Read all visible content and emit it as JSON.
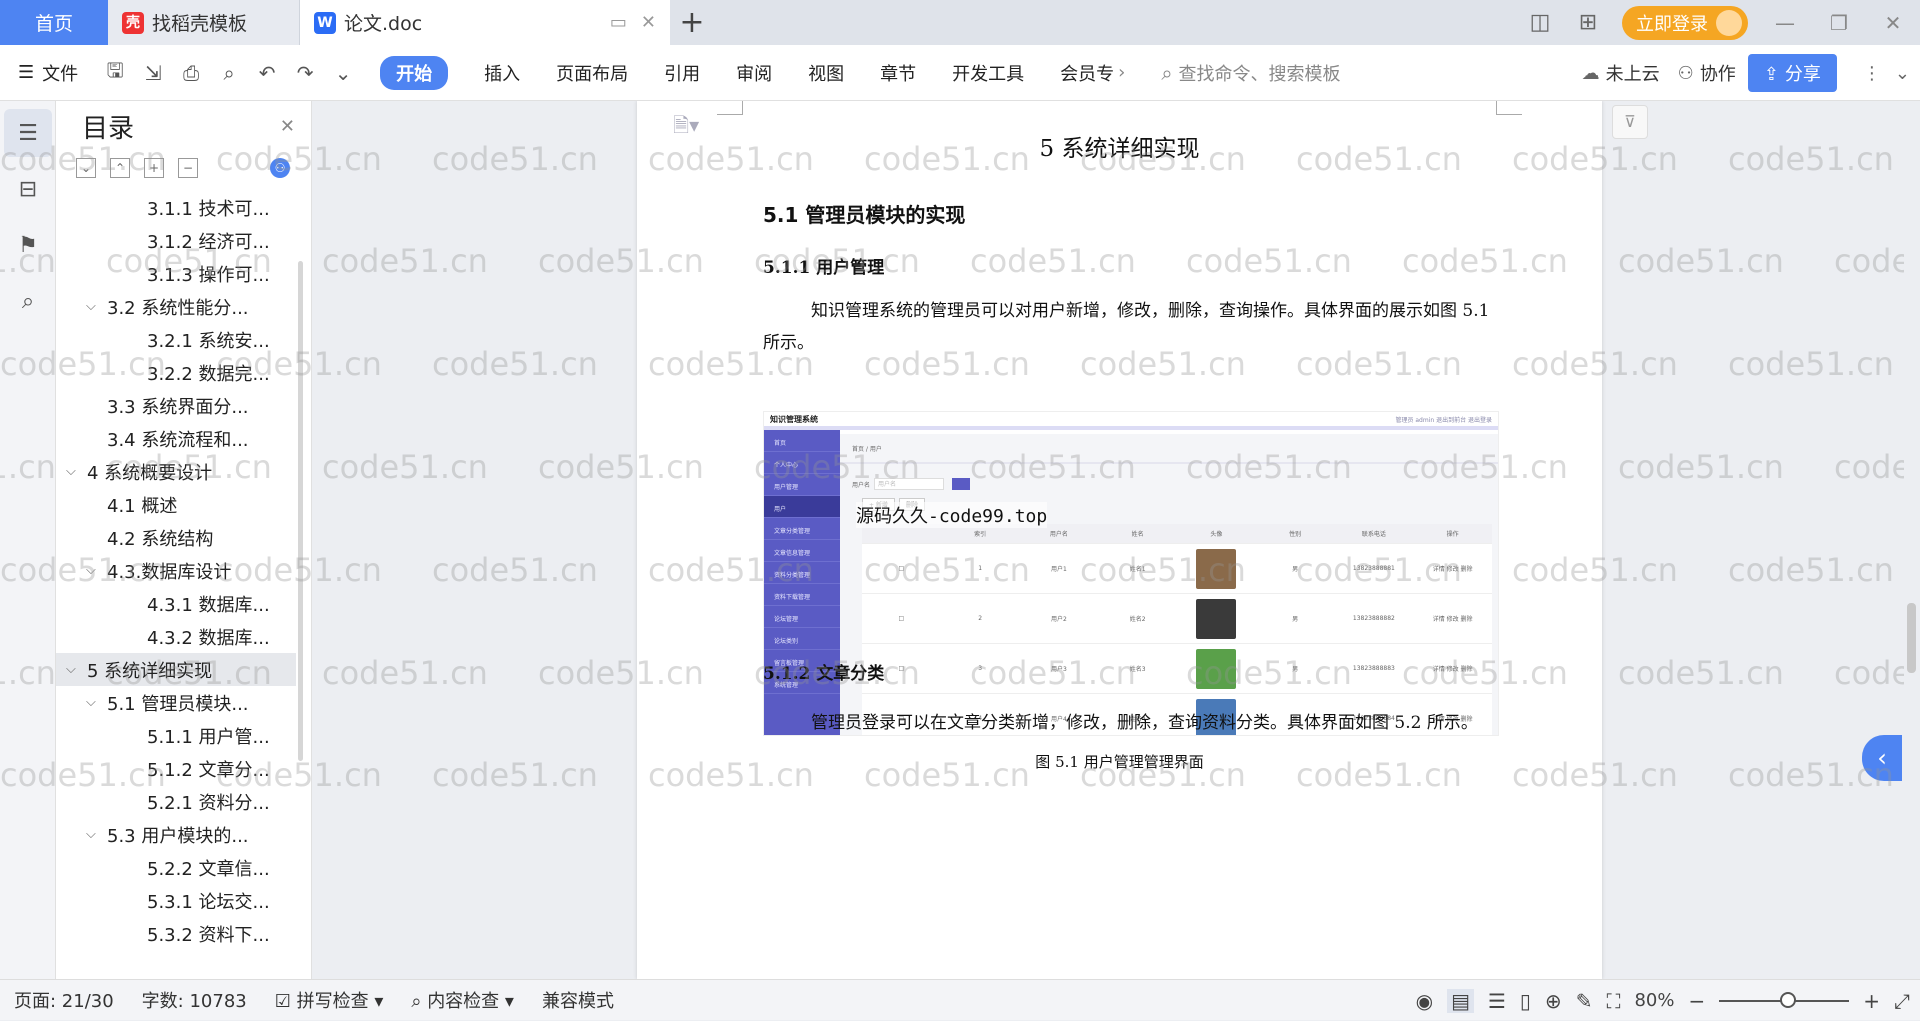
{
  "titlebar": {
    "tabs": [
      {
        "label": "首页"
      },
      {
        "label": "找稻壳模板"
      },
      {
        "label": "论文.doc"
      }
    ],
    "login_label": "立即登录"
  },
  "menubar": {
    "file_label": "文件",
    "items": [
      "开始",
      "插入",
      "页面布局",
      "引用",
      "审阅",
      "视图",
      "章节",
      "开发工具",
      "会员专"
    ],
    "search_placeholder": "查找命令、搜索模板",
    "cloud_label": "未上云",
    "collab_label": "协作",
    "share_label": "分享"
  },
  "toc": {
    "title": "目录",
    "items": [
      {
        "label": "3.1.1 技术可...",
        "level": 3
      },
      {
        "label": "3.1.2 经济可...",
        "level": 3
      },
      {
        "label": "3.1.3 操作可...",
        "level": 3
      },
      {
        "label": "3.2 系统性能分...",
        "level": 2,
        "expanded": true
      },
      {
        "label": "3.2.1  系统安...",
        "level": 3
      },
      {
        "label": "3.2.2  数据完...",
        "level": 3
      },
      {
        "label": "3.3 系统界面分...",
        "level": 2
      },
      {
        "label": "3.4 系统流程和...",
        "level": 2
      },
      {
        "label": "4 系统概要设计",
        "level": 1,
        "expanded": true
      },
      {
        "label": "4.1 概述",
        "level": 2
      },
      {
        "label": "4.2 系统结构",
        "level": 2
      },
      {
        "label": "4.3.数据库设计",
        "level": 2,
        "expanded": true
      },
      {
        "label": "4.3.1 数据库...",
        "level": 3
      },
      {
        "label": "4.3.2 数据库...",
        "level": 3
      },
      {
        "label": "5 系统详细实现",
        "level": 1,
        "expanded": true,
        "selected": true
      },
      {
        "label": "5.1  管理员模块...",
        "level": 2,
        "expanded": true
      },
      {
        "label": "5.1.1  用户管...",
        "level": 3
      },
      {
        "label": "5.1.2  文章分...",
        "level": 3
      },
      {
        "label": "5.2.1  资料分...",
        "level": 3
      },
      {
        "label": "5.3  用户模块的...",
        "level": 2,
        "expanded": true
      },
      {
        "label": "5.2.2  文章信...",
        "level": 3
      },
      {
        "label": "5.3.1  论坛交...",
        "level": 3
      },
      {
        "label": "5.3.2  资料下...",
        "level": 3
      }
    ]
  },
  "document": {
    "chapter_title": "5 系统详细实现",
    "section_title": "5.1  管理员模块的实现",
    "sub1_title": "5.1.1  用户管理",
    "para1": "知识管理系统的管理员可以对用户新增，修改，删除，查询操作。具体界面的展示如图 5.1 所示。",
    "figure_caption": "图 5.1  用户管理管理界面",
    "sub2_title": "5.1.2  文章分类",
    "para2": "管理员登录可以在文章分类新增，修改，删除，查询资料分类。具体界面如图 5.2 所示。",
    "overlay_watermark": "源码久久-code99.top",
    "watermark": "code51.cn"
  },
  "screenshot": {
    "app_title": "知识管理系统",
    "top_links": "管理员 admin    退出到前台    退出登录",
    "breadcrumb": "首页 / 用户",
    "search_label": "用户名",
    "search_placeholder": "用户名",
    "add_label": "+ 新增",
    "del_label": "删除",
    "menu": [
      "首页",
      "个人中心",
      "用户管理",
      "用户",
      "文章分类管理",
      "文章信息管理",
      "资料分类管理",
      "资料下载管理",
      "论坛管理",
      "论坛类别",
      "留言板管理",
      "系统管理"
    ],
    "headers": [
      "",
      "索引",
      "用户名",
      "姓名",
      "头像",
      "性别",
      "联系电话",
      "操作"
    ],
    "rows": [
      {
        "idx": "1",
        "user": "用户1",
        "name": "姓名1",
        "sex": "男",
        "phone": "13823888881",
        "color": "#8a6a4a"
      },
      {
        "idx": "2",
        "user": "用户2",
        "name": "姓名2",
        "sex": "男",
        "phone": "13823888882",
        "color": "#3a3a3a"
      },
      {
        "idx": "3",
        "user": "用户3",
        "name": "姓名3",
        "sex": "男",
        "phone": "13823888883",
        "color": "#5aa04a"
      },
      {
        "idx": "4",
        "user": "用户4",
        "name": "姓名4",
        "sex": "男",
        "phone": "13823888884",
        "color": "#4a7ab8"
      }
    ],
    "ops": "详情   修改   删除"
  },
  "statusbar": {
    "page": "页面: 21/30",
    "words": "字数: 10783",
    "spell": "拼写检查",
    "content": "内容检查",
    "compat": "兼容模式",
    "zoom": "80%",
    "zoom_fraction": 0.5
  }
}
